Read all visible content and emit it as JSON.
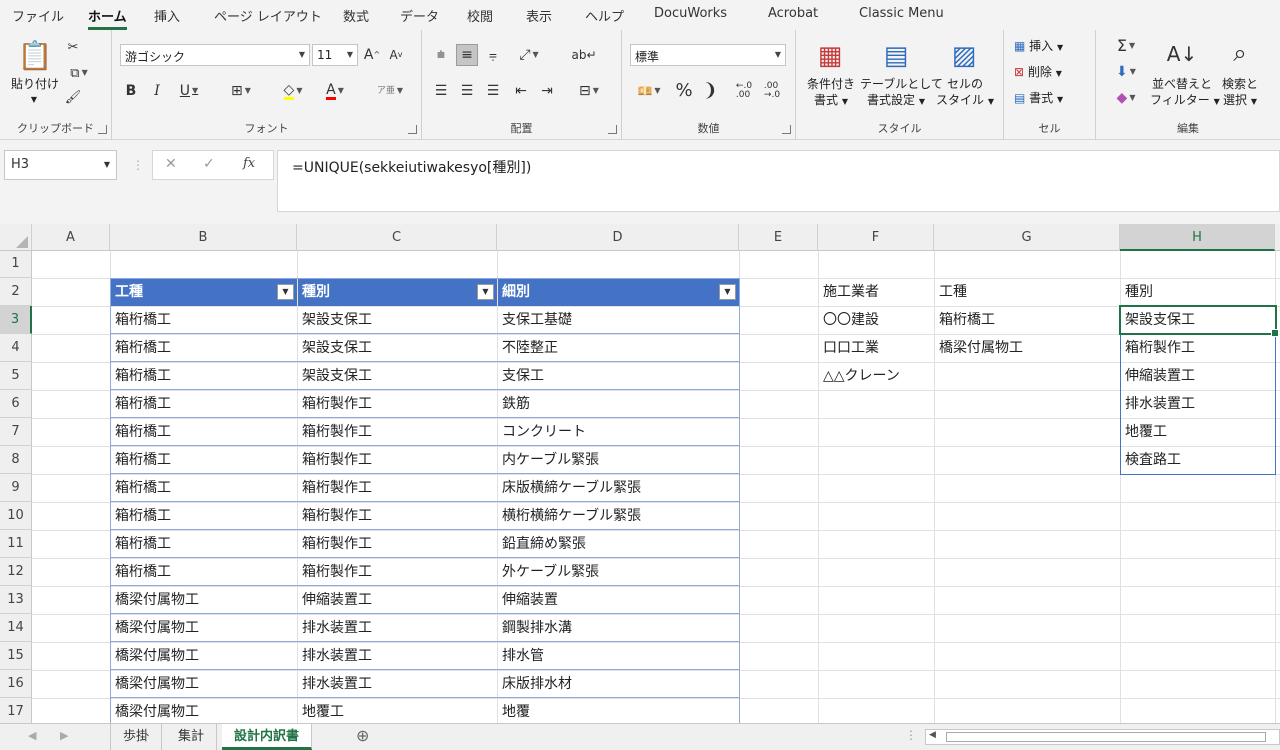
{
  "menu": {
    "tabs": [
      "ファイル",
      "ホーム",
      "挿入",
      "ページ レイアウト",
      "数式",
      "データ",
      "校閲",
      "表示",
      "ヘルプ",
      "DocuWorks",
      "Acrobat",
      "Classic Menu"
    ],
    "active": "ホーム"
  },
  "ribbon": {
    "clipboard": {
      "label": "クリップボード",
      "paste": "貼り付け"
    },
    "font": {
      "label": "フォント",
      "name": "游ゴシック",
      "size": "11",
      "bold": "B",
      "italic": "I",
      "underline": "U",
      "grow": "A",
      "shrink": "A",
      "font_color": "A",
      "phonetic": "ア亜"
    },
    "alignment": {
      "label": "配置"
    },
    "number": {
      "label": "数値",
      "format": "標準",
      "percent": "%",
      "comma": "❩"
    },
    "styles": {
      "label": "スタイル",
      "cond1": "条件付き",
      "cond2": "書式",
      "table1": "テーブルとして",
      "table2": "書式設定",
      "cell1": "セルの",
      "cell2": "スタイル"
    },
    "cells": {
      "label": "セル",
      "insert": "挿入",
      "delete": "削除",
      "format": "書式"
    },
    "editing": {
      "label": "編集",
      "sum": "Σ",
      "sort1": "並べ替えと",
      "sort2": "フィルター",
      "find1": "検索と",
      "find2": "選択"
    }
  },
  "formula_bar": {
    "name_box": "H3",
    "cancel": "✕",
    "enter": "✓",
    "fx": "fx",
    "formula": "=UNIQUE(sekkeiutiwakesyo[種別])"
  },
  "grid": {
    "columns": [
      "A",
      "B",
      "C",
      "D",
      "E",
      "F",
      "G",
      "H"
    ],
    "selected_column": "H",
    "rows": [
      "1",
      "2",
      "3",
      "4",
      "5",
      "6",
      "7",
      "8",
      "9",
      "10",
      "11",
      "12",
      "13",
      "14",
      "15",
      "16",
      "17"
    ],
    "selected_row": "3"
  },
  "table": {
    "headers": [
      "工種",
      "種別",
      "細別"
    ],
    "rows": [
      [
        "箱桁橋工",
        "架設支保工",
        "支保工基礎"
      ],
      [
        "箱桁橋工",
        "架設支保工",
        "不陸整正"
      ],
      [
        "箱桁橋工",
        "架設支保工",
        "支保工"
      ],
      [
        "箱桁橋工",
        "箱桁製作工",
        "鉄筋"
      ],
      [
        "箱桁橋工",
        "箱桁製作工",
        "コンクリート"
      ],
      [
        "箱桁橋工",
        "箱桁製作工",
        "内ケーブル緊張"
      ],
      [
        "箱桁橋工",
        "箱桁製作工",
        "床版横締ケーブル緊張"
      ],
      [
        "箱桁橋工",
        "箱桁製作工",
        "横桁横締ケーブル緊張"
      ],
      [
        "箱桁橋工",
        "箱桁製作工",
        "鉛直締め緊張"
      ],
      [
        "箱桁橋工",
        "箱桁製作工",
        "外ケーブル緊張"
      ],
      [
        "橋梁付属物工",
        "伸縮装置工",
        "伸縮装置"
      ],
      [
        "橋梁付属物工",
        "排水装置工",
        "鋼製排水溝"
      ],
      [
        "橋梁付属物工",
        "排水装置工",
        "排水管"
      ],
      [
        "橋梁付属物工",
        "排水装置工",
        "床版排水材"
      ],
      [
        "橋梁付属物工",
        "地覆工",
        "地覆"
      ]
    ]
  },
  "side": {
    "headers": [
      "施工業者",
      "工種",
      "種別"
    ],
    "contractors": [
      "〇〇建設",
      "口口工業",
      "△△クレーン"
    ],
    "kouji": [
      "箱桁橋工",
      "橋梁付属物工"
    ],
    "shubetsu": [
      "架設支保工",
      "箱桁製作工",
      "伸縮装置工",
      "排水装置工",
      "地覆工",
      "検査路工"
    ]
  },
  "sheets": {
    "tabs": [
      "歩掛",
      "集計",
      "設計内訳書"
    ],
    "active": "設計内訳書",
    "add": "⊕"
  }
}
